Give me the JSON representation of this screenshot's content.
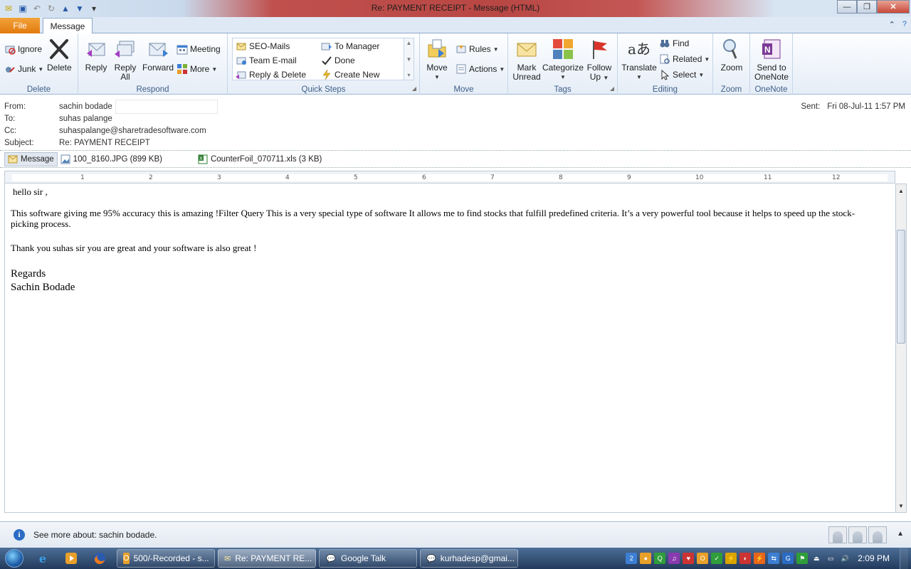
{
  "window": {
    "title": "Re: PAYMENT RECEIPT  -  Message (HTML)",
    "qat_icons": [
      "outlook-icon",
      "save-icon",
      "undo-icon",
      "redo-icon",
      "up-icon",
      "down-icon",
      "customize-icon"
    ]
  },
  "tabs": {
    "file": "File",
    "message": "Message"
  },
  "ribbon": {
    "delete": {
      "label": "Delete",
      "ignore": "Ignore",
      "junk": "Junk",
      "delete_btn": "Delete"
    },
    "respond": {
      "label": "Respond",
      "reply": "Reply",
      "reply_all_1": "Reply",
      "reply_all_2": "All",
      "forward": "Forward",
      "meeting": "Meeting",
      "more": "More"
    },
    "quick_steps": {
      "label": "Quick Steps",
      "items": [
        "SEO-Mails",
        "To Manager",
        "Team E-mail",
        "Done",
        "Reply & Delete",
        "Create New"
      ]
    },
    "move": {
      "label": "Move",
      "move_btn": "Move",
      "rules": "Rules",
      "actions": "Actions"
    },
    "tags": {
      "label": "Tags",
      "mark_unread_1": "Mark",
      "mark_unread_2": "Unread",
      "categorize": "Categorize",
      "follow_up_1": "Follow",
      "follow_up_2": "Up"
    },
    "editing": {
      "label": "Editing",
      "translate": "Translate",
      "find": "Find",
      "related": "Related",
      "select": "Select"
    },
    "zoom": {
      "label": "Zoom",
      "zoom_btn": "Zoom"
    },
    "onenote": {
      "label": "OneNote",
      "send_1": "Send to",
      "send_2": "OneNote"
    }
  },
  "header": {
    "from_label": "From:",
    "from": "sachin bodade",
    "to_label": "To:",
    "to": "suhas palange",
    "cc_label": "Cc:",
    "cc": "suhaspalange@sharetradesoftware.com",
    "subject_label": "Subject:",
    "subject": "Re: PAYMENT RECEIPT",
    "sent_label": "Sent:",
    "sent": "Fri 08-Jul-11 1:57 PM"
  },
  "attachments": {
    "message": "Message",
    "items": [
      "100_8160.JPG (899 KB)",
      "CounterFoil_070711.xls (3 KB)"
    ]
  },
  "ruler": {
    "ticks": [
      "1",
      "2",
      "3",
      "4",
      "5",
      "6",
      "7",
      "8",
      "9",
      "10",
      "11",
      "12"
    ]
  },
  "body": {
    "greeting": "hello sir ,",
    "para1a": "This software giving me 95% accuracy this is amazing !Filter Query This is a very special type of software It allows me to find stocks that fulfill predefined criteria. It’s a very powerful tool because it helps to speed up the stock-",
    "para1b": "picking process.",
    "para2": "Thank you suhas sir you are great and your software is also great !",
    "regards": "Regards",
    "signature": "Sachin Bodade"
  },
  "infobar": {
    "text": "See more about: sachin bodade."
  },
  "taskbar": {
    "tasks": [
      "500/-Recorded - s...",
      "Re: PAYMENT RE...",
      "Google Talk",
      "kurhadesp@gmai..."
    ],
    "clock": "2:09 PM"
  },
  "colors": {
    "file_tab": "#e27a0f",
    "title_accent": "#c0504d",
    "taskbar": "#223a5c"
  }
}
